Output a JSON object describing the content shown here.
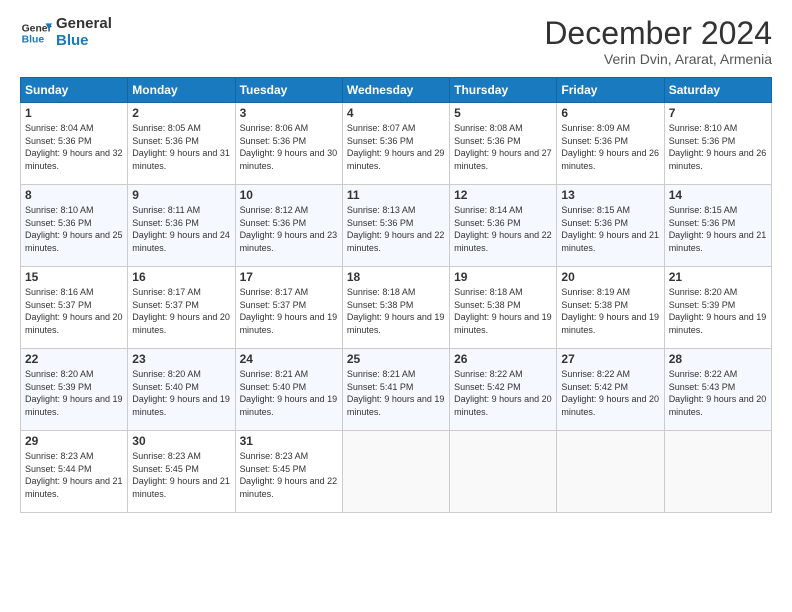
{
  "logo": {
    "line1": "General",
    "line2": "Blue"
  },
  "header": {
    "title": "December 2024",
    "subtitle": "Verin Dvin, Ararat, Armenia"
  },
  "weekdays": [
    "Sunday",
    "Monday",
    "Tuesday",
    "Wednesday",
    "Thursday",
    "Friday",
    "Saturday"
  ],
  "weeks": [
    [
      {
        "day": "1",
        "sunrise": "Sunrise: 8:04 AM",
        "sunset": "Sunset: 5:36 PM",
        "daylight": "Daylight: 9 hours and 32 minutes."
      },
      {
        "day": "2",
        "sunrise": "Sunrise: 8:05 AM",
        "sunset": "Sunset: 5:36 PM",
        "daylight": "Daylight: 9 hours and 31 minutes."
      },
      {
        "day": "3",
        "sunrise": "Sunrise: 8:06 AM",
        "sunset": "Sunset: 5:36 PM",
        "daylight": "Daylight: 9 hours and 30 minutes."
      },
      {
        "day": "4",
        "sunrise": "Sunrise: 8:07 AM",
        "sunset": "Sunset: 5:36 PM",
        "daylight": "Daylight: 9 hours and 29 minutes."
      },
      {
        "day": "5",
        "sunrise": "Sunrise: 8:08 AM",
        "sunset": "Sunset: 5:36 PM",
        "daylight": "Daylight: 9 hours and 27 minutes."
      },
      {
        "day": "6",
        "sunrise": "Sunrise: 8:09 AM",
        "sunset": "Sunset: 5:36 PM",
        "daylight": "Daylight: 9 hours and 26 minutes."
      },
      {
        "day": "7",
        "sunrise": "Sunrise: 8:10 AM",
        "sunset": "Sunset: 5:36 PM",
        "daylight": "Daylight: 9 hours and 26 minutes."
      }
    ],
    [
      {
        "day": "8",
        "sunrise": "Sunrise: 8:10 AM",
        "sunset": "Sunset: 5:36 PM",
        "daylight": "Daylight: 9 hours and 25 minutes."
      },
      {
        "day": "9",
        "sunrise": "Sunrise: 8:11 AM",
        "sunset": "Sunset: 5:36 PM",
        "daylight": "Daylight: 9 hours and 24 minutes."
      },
      {
        "day": "10",
        "sunrise": "Sunrise: 8:12 AM",
        "sunset": "Sunset: 5:36 PM",
        "daylight": "Daylight: 9 hours and 23 minutes."
      },
      {
        "day": "11",
        "sunrise": "Sunrise: 8:13 AM",
        "sunset": "Sunset: 5:36 PM",
        "daylight": "Daylight: 9 hours and 22 minutes."
      },
      {
        "day": "12",
        "sunrise": "Sunrise: 8:14 AM",
        "sunset": "Sunset: 5:36 PM",
        "daylight": "Daylight: 9 hours and 22 minutes."
      },
      {
        "day": "13",
        "sunrise": "Sunrise: 8:15 AM",
        "sunset": "Sunset: 5:36 PM",
        "daylight": "Daylight: 9 hours and 21 minutes."
      },
      {
        "day": "14",
        "sunrise": "Sunrise: 8:15 AM",
        "sunset": "Sunset: 5:36 PM",
        "daylight": "Daylight: 9 hours and 21 minutes."
      }
    ],
    [
      {
        "day": "15",
        "sunrise": "Sunrise: 8:16 AM",
        "sunset": "Sunset: 5:37 PM",
        "daylight": "Daylight: 9 hours and 20 minutes."
      },
      {
        "day": "16",
        "sunrise": "Sunrise: 8:17 AM",
        "sunset": "Sunset: 5:37 PM",
        "daylight": "Daylight: 9 hours and 20 minutes."
      },
      {
        "day": "17",
        "sunrise": "Sunrise: 8:17 AM",
        "sunset": "Sunset: 5:37 PM",
        "daylight": "Daylight: 9 hours and 19 minutes."
      },
      {
        "day": "18",
        "sunrise": "Sunrise: 8:18 AM",
        "sunset": "Sunset: 5:38 PM",
        "daylight": "Daylight: 9 hours and 19 minutes."
      },
      {
        "day": "19",
        "sunrise": "Sunrise: 8:18 AM",
        "sunset": "Sunset: 5:38 PM",
        "daylight": "Daylight: 9 hours and 19 minutes."
      },
      {
        "day": "20",
        "sunrise": "Sunrise: 8:19 AM",
        "sunset": "Sunset: 5:38 PM",
        "daylight": "Daylight: 9 hours and 19 minutes."
      },
      {
        "day": "21",
        "sunrise": "Sunrise: 8:20 AM",
        "sunset": "Sunset: 5:39 PM",
        "daylight": "Daylight: 9 hours and 19 minutes."
      }
    ],
    [
      {
        "day": "22",
        "sunrise": "Sunrise: 8:20 AM",
        "sunset": "Sunset: 5:39 PM",
        "daylight": "Daylight: 9 hours and 19 minutes."
      },
      {
        "day": "23",
        "sunrise": "Sunrise: 8:20 AM",
        "sunset": "Sunset: 5:40 PM",
        "daylight": "Daylight: 9 hours and 19 minutes."
      },
      {
        "day": "24",
        "sunrise": "Sunrise: 8:21 AM",
        "sunset": "Sunset: 5:40 PM",
        "daylight": "Daylight: 9 hours and 19 minutes."
      },
      {
        "day": "25",
        "sunrise": "Sunrise: 8:21 AM",
        "sunset": "Sunset: 5:41 PM",
        "daylight": "Daylight: 9 hours and 19 minutes."
      },
      {
        "day": "26",
        "sunrise": "Sunrise: 8:22 AM",
        "sunset": "Sunset: 5:42 PM",
        "daylight": "Daylight: 9 hours and 20 minutes."
      },
      {
        "day": "27",
        "sunrise": "Sunrise: 8:22 AM",
        "sunset": "Sunset: 5:42 PM",
        "daylight": "Daylight: 9 hours and 20 minutes."
      },
      {
        "day": "28",
        "sunrise": "Sunrise: 8:22 AM",
        "sunset": "Sunset: 5:43 PM",
        "daylight": "Daylight: 9 hours and 20 minutes."
      }
    ],
    [
      {
        "day": "29",
        "sunrise": "Sunrise: 8:23 AM",
        "sunset": "Sunset: 5:44 PM",
        "daylight": "Daylight: 9 hours and 21 minutes."
      },
      {
        "day": "30",
        "sunrise": "Sunrise: 8:23 AM",
        "sunset": "Sunset: 5:45 PM",
        "daylight": "Daylight: 9 hours and 21 minutes."
      },
      {
        "day": "31",
        "sunrise": "Sunrise: 8:23 AM",
        "sunset": "Sunset: 5:45 PM",
        "daylight": "Daylight: 9 hours and 22 minutes."
      },
      null,
      null,
      null,
      null
    ]
  ]
}
